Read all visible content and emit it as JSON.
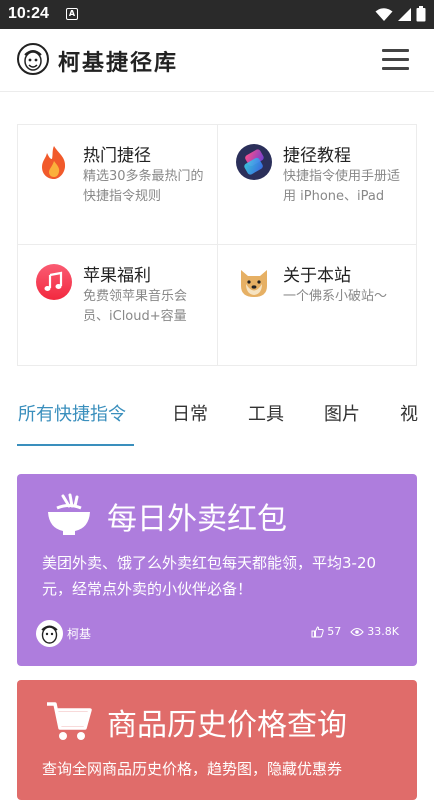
{
  "status_bar": {
    "time": "10:24",
    "notif_glyph": "A"
  },
  "header": {
    "site_title": "柯基捷径库",
    "logo_icon": "corgi-avatar-icon",
    "menu_icon": "hamburger-menu-icon"
  },
  "categories": [
    {
      "title": "热门捷径",
      "desc": "精选30多条最热门的快捷指令规则",
      "icon": "fire-icon"
    },
    {
      "title": "捷径教程",
      "desc": "快捷指令使用手册适用 iPhone、iPad",
      "icon": "shortcuts-app-icon"
    },
    {
      "title": "苹果福利",
      "desc": "免费领苹果音乐会员、iCloud+容量",
      "icon": "apple-music-icon"
    },
    {
      "title": "关于本站",
      "desc": "一个佛系小破站～",
      "icon": "doge-icon"
    }
  ],
  "tabs": [
    "所有快捷指令",
    "日常",
    "工具",
    "图片",
    "视"
  ],
  "active_tab": 0,
  "cards": [
    {
      "title": "每日外卖红包",
      "desc": "美团外卖、饿了么外卖红包每天都能领，平均3-20元，经常点外卖的小伙伴必备！",
      "author": "柯基",
      "likes": "57",
      "views": "33.8K",
      "icon": "food-bowl-icon",
      "color": "#ae7ddd"
    },
    {
      "title": "商品历史价格查询",
      "desc": "查询全网商品历史价格，趋势图，隐藏优惠券",
      "icon": "shopping-cart-icon",
      "color": "#e06c6a"
    }
  ],
  "colors": {
    "accent": "#3a8fbd",
    "statusbar": "#2a2a2a"
  }
}
